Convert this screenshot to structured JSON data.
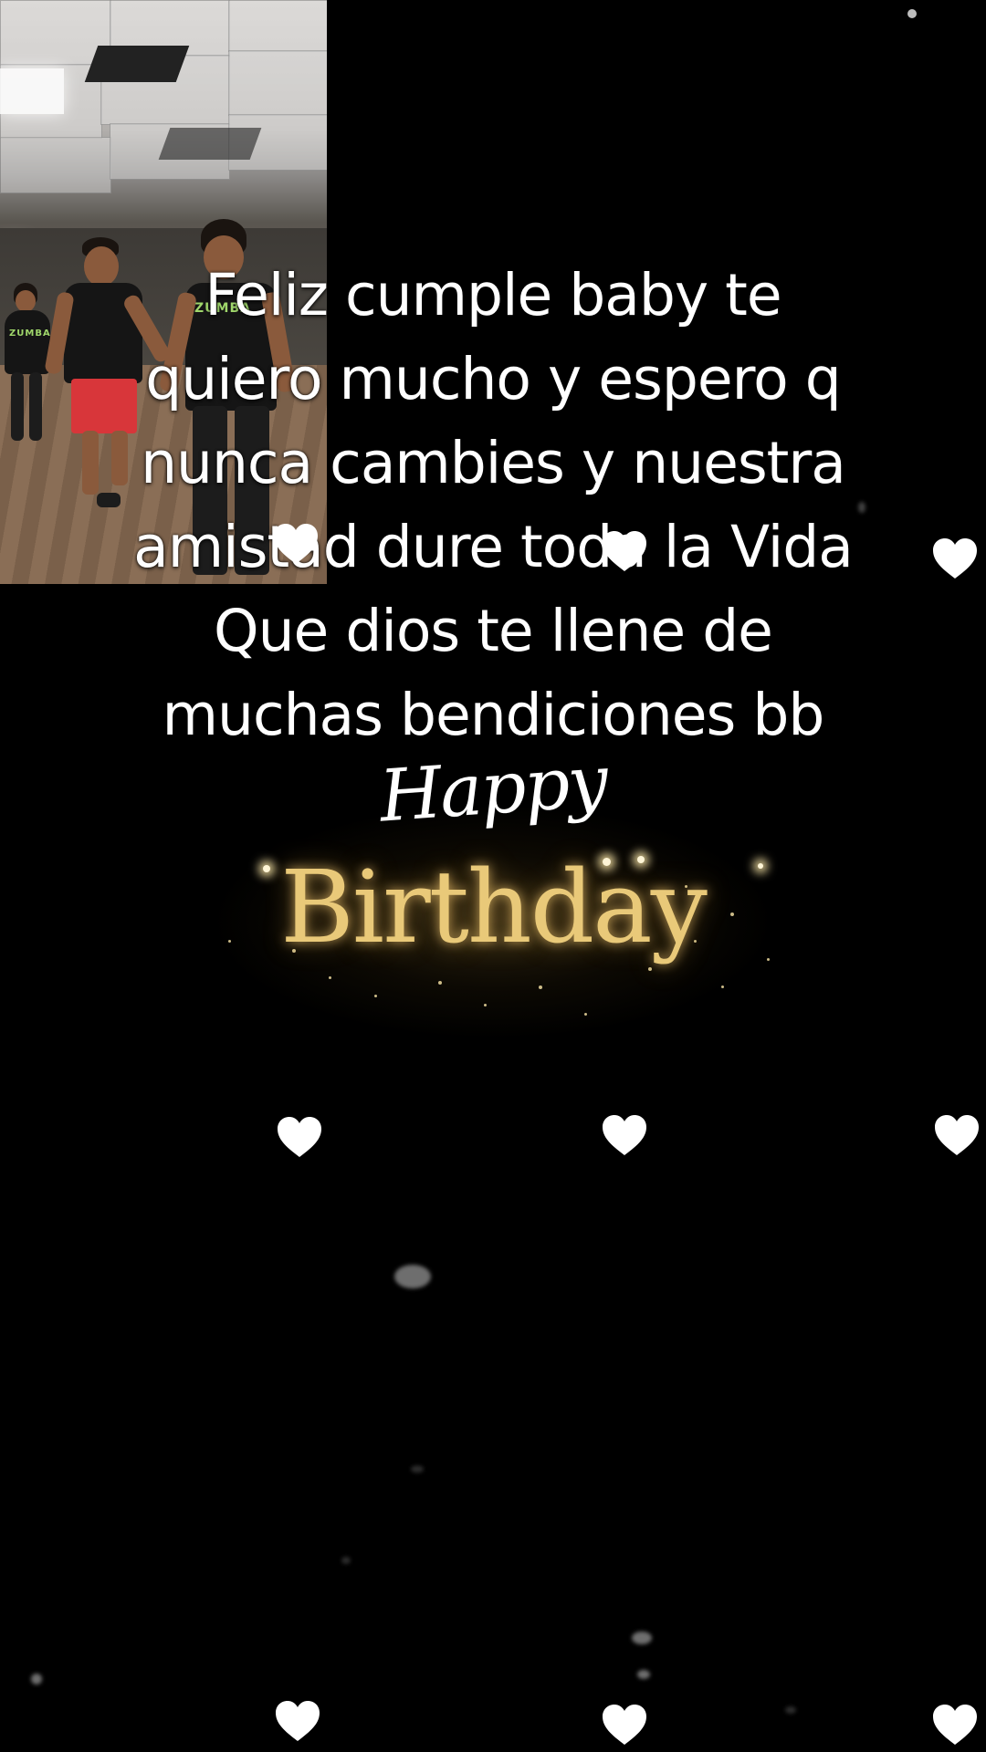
{
  "overlay": {
    "caption_lines": [
      "Feliz cumple baby te",
      "quiero mucho y espero q",
      "nunca cambies y nuestra",
      "amistad dure toda la Vida",
      "Que dios te llene de",
      "muchas bendiciones bb"
    ]
  },
  "graphic": {
    "happy": "Happy",
    "birthday": "Birthday",
    "gold_color": "#e9c979"
  },
  "photo": {
    "shirt_print": "ZUMBA",
    "description_icons": [
      "dancer-figure",
      "dancer-figure",
      "dancer-figure"
    ]
  },
  "decor": {
    "heart_icon": "heart-icon",
    "heart_color": "#ffffff"
  }
}
